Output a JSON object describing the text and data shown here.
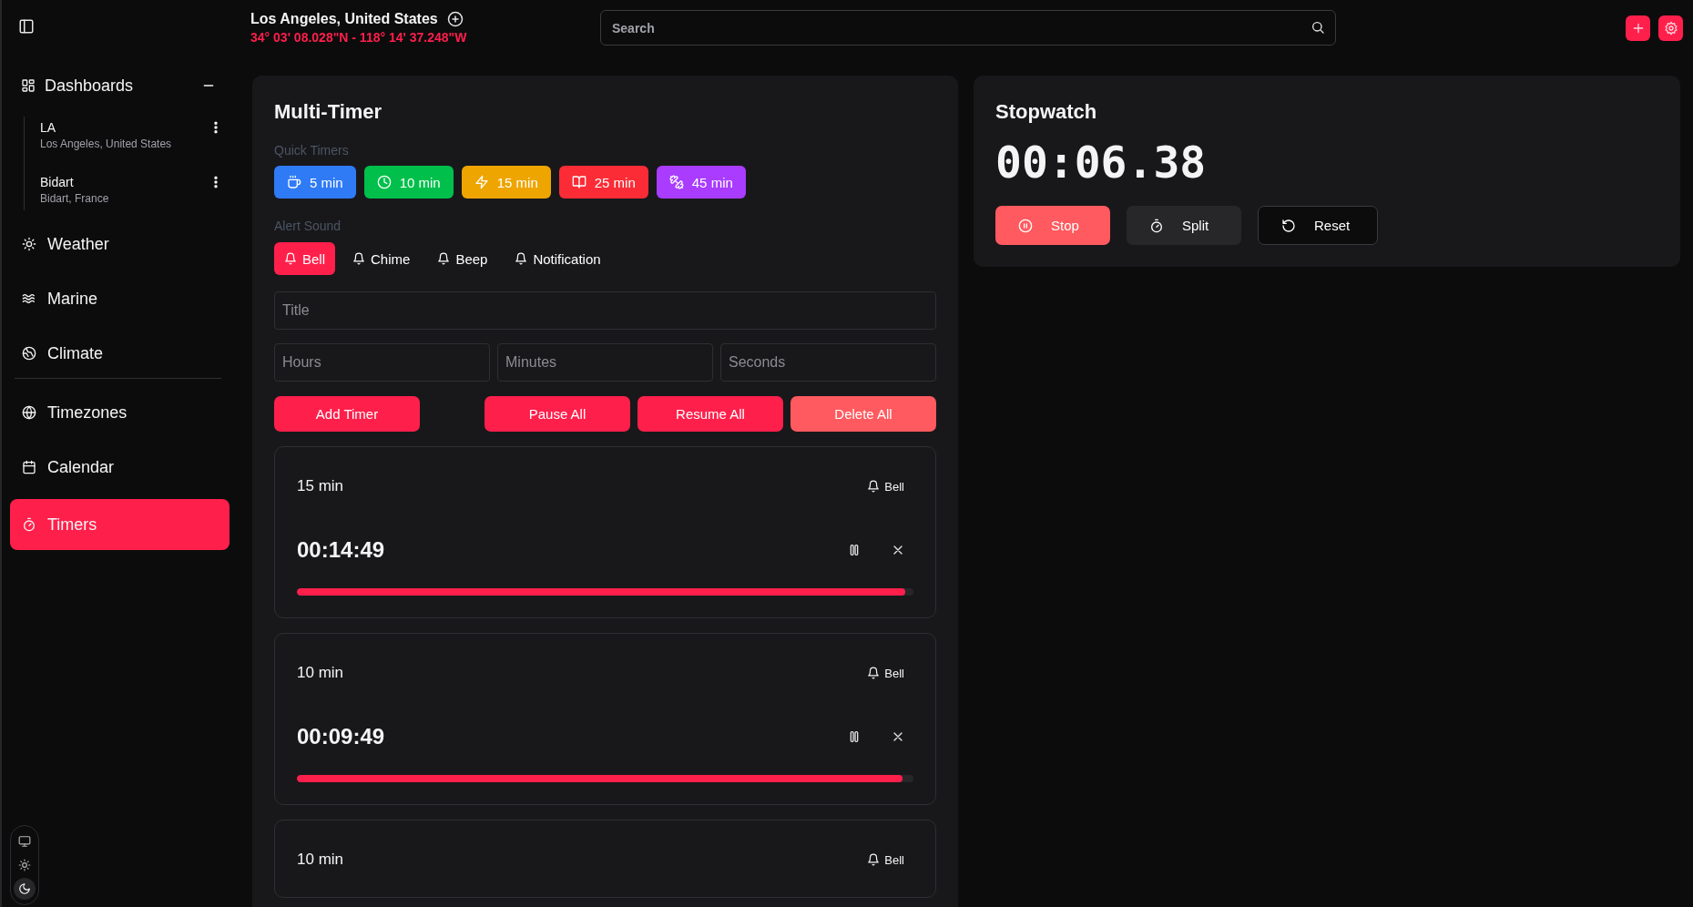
{
  "header": {
    "location": "Los Angeles, United States",
    "coordinates": "34° 03' 08.028\"N - 118° 14' 37.248\"W",
    "search": {
      "placeholder": "Search"
    }
  },
  "sidebar": {
    "dashboards": {
      "label": "Dashboards",
      "expanded": true,
      "items": [
        {
          "name": "LA",
          "location": "Los Angeles, United States"
        },
        {
          "name": "Bidart",
          "location": "Bidart, France"
        }
      ]
    },
    "nav_groups": [
      [
        {
          "label": "Weather",
          "selected": false
        },
        {
          "label": "Marine",
          "selected": false
        },
        {
          "label": "Climate",
          "selected": false
        }
      ],
      [
        {
          "label": "Timezones",
          "selected": false
        },
        {
          "label": "Calendar",
          "selected": false
        },
        {
          "label": "Timers",
          "selected": true
        }
      ]
    ],
    "theme_options": [
      {
        "kind": "system",
        "selected": false
      },
      {
        "kind": "light",
        "selected": false
      },
      {
        "kind": "dark",
        "selected": true
      }
    ]
  },
  "multi_timer": {
    "title": "Multi-Timer",
    "quick_label": "Quick Timers",
    "quick_timers": [
      {
        "label": "5 min",
        "color": "#2f7bf6"
      },
      {
        "label": "10 min",
        "color": "#00c04b"
      },
      {
        "label": "15 min",
        "color": "#eea500"
      },
      {
        "label": "25 min",
        "color": "#fb2c36"
      },
      {
        "label": "45 min",
        "color": "#a93cff"
      }
    ],
    "sound_label": "Alert Sound",
    "sounds": [
      {
        "label": "Bell",
        "selected": true
      },
      {
        "label": "Chime",
        "selected": false
      },
      {
        "label": "Beep",
        "selected": false
      },
      {
        "label": "Notification",
        "selected": false
      }
    ],
    "title_field": {
      "placeholder": "Title"
    },
    "time_fields": [
      {
        "placeholder": "Hours"
      },
      {
        "placeholder": "Minutes"
      },
      {
        "placeholder": "Seconds"
      }
    ],
    "add_button": {
      "label": "Add Timer",
      "kind": "primary"
    },
    "bulk_buttons": [
      {
        "label": "Pause All",
        "kind": "primary"
      },
      {
        "label": "Resume All",
        "kind": "primary"
      },
      {
        "label": "Delete All",
        "kind": "danger"
      }
    ],
    "timers": [
      {
        "title": "15 min",
        "sound": "Bell",
        "time": "00:14:49",
        "running": true,
        "level": 0.987
      },
      {
        "title": "10 min",
        "sound": "Bell",
        "time": "00:09:49",
        "running": true,
        "level": 0.982
      },
      {
        "title": "10 min",
        "sound": "Bell"
      }
    ]
  },
  "stopwatch": {
    "title": "Stopwatch",
    "time": "00:06.38",
    "buttons": [
      {
        "label": "Stop",
        "kind": "danger"
      },
      {
        "label": "Split",
        "kind": "secondary"
      },
      {
        "label": "Reset",
        "kind": "outline"
      }
    ]
  }
}
